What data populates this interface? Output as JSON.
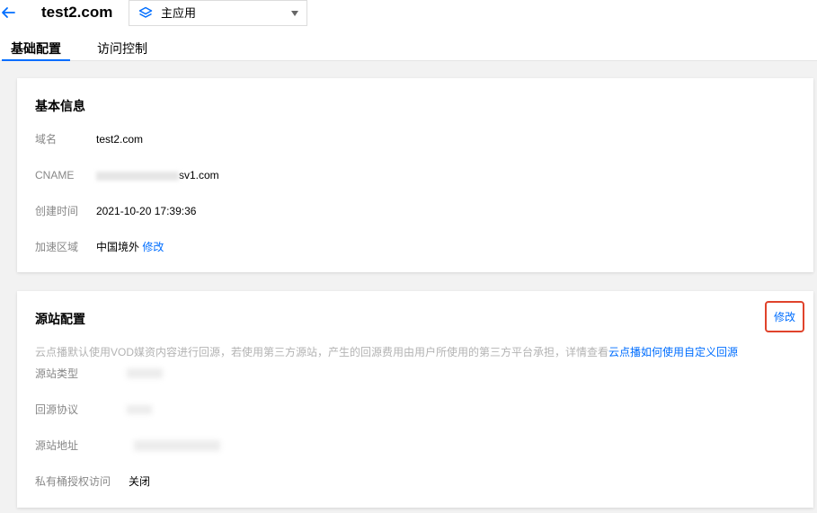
{
  "header": {
    "domain_title": "test2.com",
    "app_select_value": "主应用"
  },
  "tabs": [
    {
      "label": "基础配置",
      "active": true
    },
    {
      "label": "访问控制",
      "active": false
    }
  ],
  "basic_info": {
    "title": "基本信息",
    "rows": [
      {
        "label": "域名",
        "value": "test2.com"
      },
      {
        "label": "CNAME",
        "value": "sv1.com"
      },
      {
        "label": "创建时间",
        "value": "2021-10-20 17:39:36"
      },
      {
        "label": "加速区域",
        "value": "中国境外",
        "link": "修改"
      }
    ]
  },
  "origin_config": {
    "title": "源站配置",
    "edit_label": "修改",
    "notice_text": "云点播默认使用VOD媒资内容进行回源，若使用第三方源站，产生的回源费用由用户所使用的第三方平台承担，详情查看",
    "notice_link": "云点播如何使用自定义回源",
    "rows": [
      {
        "label": "源站类型"
      },
      {
        "label": "回源协议"
      },
      {
        "label": "源站地址"
      },
      {
        "label": "私有桶授权访问",
        "value": "关闭"
      }
    ]
  },
  "colors": {
    "accent": "#006eff",
    "highlight_border": "#e0432b"
  },
  "icons": [
    "back-arrow-icon",
    "layers-icon",
    "caret-down-icon"
  ]
}
